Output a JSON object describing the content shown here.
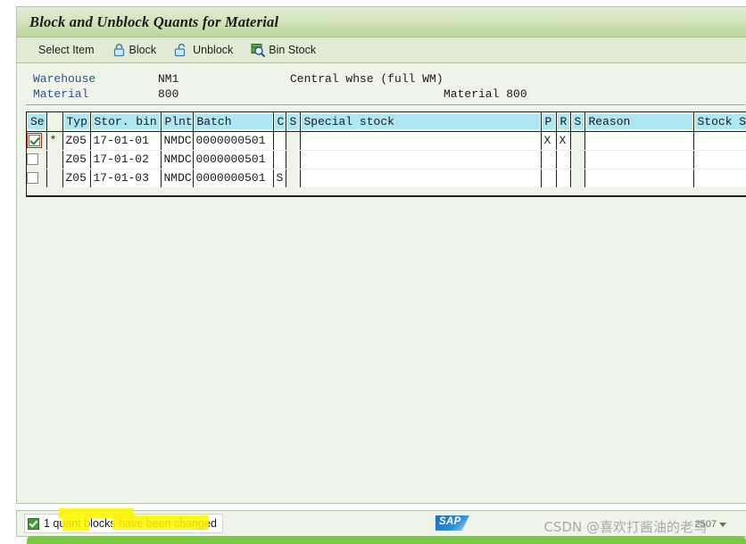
{
  "window": {
    "title": "Block and Unblock Quants for Material"
  },
  "toolbar": {
    "items": [
      {
        "label": "Select Item",
        "icon": "none"
      },
      {
        "label": "Block",
        "icon": "lock-closed-icon"
      },
      {
        "label": "Unblock",
        "icon": "lock-open-icon"
      },
      {
        "label": "Bin Stock",
        "icon": "bin-stock-search-icon"
      }
    ]
  },
  "header": {
    "warehouse_label": "Warehouse",
    "warehouse_value": "NM1",
    "warehouse_desc": "Central whse (full WM)",
    "material_label": "Material",
    "material_value": "800",
    "material_desc": "Material 800"
  },
  "grid": {
    "columns": [
      "Sel",
      "Typ",
      "Stor. bin",
      "Plnt",
      "Batch",
      "C",
      "S",
      "Special stock",
      "P",
      "R",
      "S",
      "Reason",
      "Stock S"
    ],
    "rows": [
      {
        "sel": true,
        "focused": true,
        "star": "*",
        "typ": "Z05",
        "stor_bin": "17-01-01",
        "plnt": "NMDC",
        "batch": "0000000501",
        "c": "",
        "s": "",
        "special_stock": "",
        "p": "X",
        "r": "X",
        "s2": "",
        "reason": "",
        "stock_s": ""
      },
      {
        "sel": false,
        "focused": false,
        "star": "",
        "typ": "Z05",
        "stor_bin": "17-01-02",
        "plnt": "NMDC",
        "batch": "0000000501",
        "c": "",
        "s": "",
        "special_stock": "",
        "p": "",
        "r": "",
        "s2": "",
        "reason": "",
        "stock_s": ""
      },
      {
        "sel": false,
        "focused": false,
        "star": "",
        "typ": "Z05",
        "stor_bin": "17-01-03",
        "plnt": "NMDC",
        "batch": "0000000501",
        "c": "S",
        "s": "",
        "special_stock": "",
        "p": "",
        "r": "",
        "s2": "",
        "reason": "",
        "stock_s": ""
      }
    ]
  },
  "status": {
    "message": "1 quant blocks have been changed",
    "icon": "success-check-icon",
    "logo": "SAP",
    "session": "2507",
    "watermark": "CSDN @喜欢打酱油的老鸟"
  },
  "colors": {
    "title_bar": "#cfe2b6",
    "toolbar": "#e2ebd5",
    "page_bg": "#eff4e9",
    "header_cell": "#aee6f2",
    "highlight": "#fdf500",
    "bottom_bar": "#7ac943",
    "label_blue": "#2a4f9e"
  }
}
